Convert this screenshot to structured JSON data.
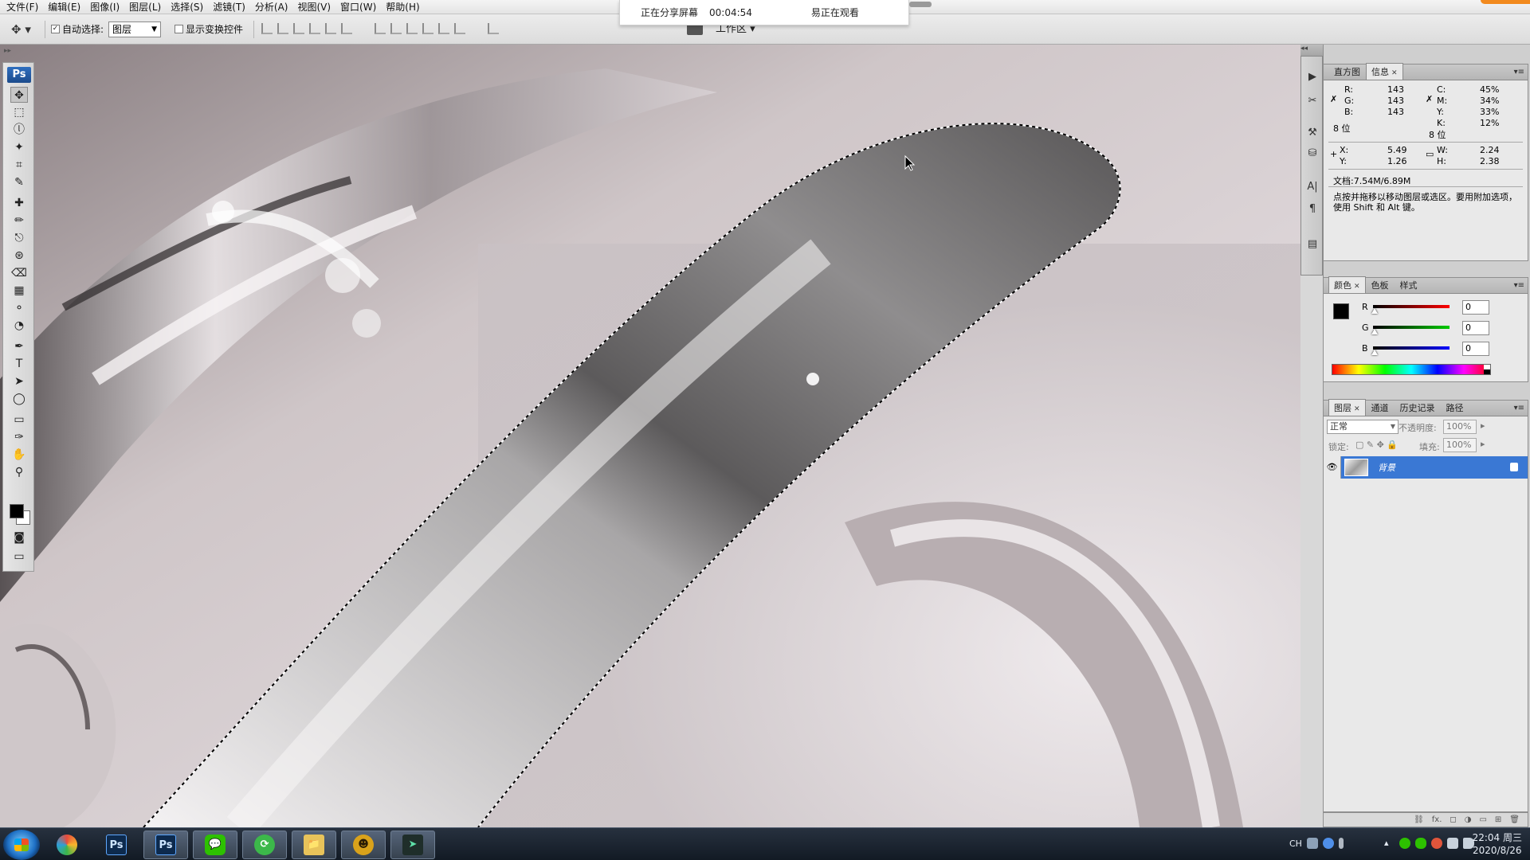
{
  "menu": [
    "文件(F)",
    "编辑(E)",
    "图像(I)",
    "图层(L)",
    "选择(S)",
    "滤镜(T)",
    "分析(A)",
    "视图(V)",
    "窗口(W)",
    "帮助(H)"
  ],
  "options": {
    "auto_select_label": "自动选择:",
    "auto_select_value": "图层",
    "auto_select_checked": "✓",
    "show_transform_label": "显示变换控件",
    "workspace_label": "工作区"
  },
  "share_banner": {
    "status": "正在分享屏幕",
    "elapsed": "00:04:54",
    "viewers": "易正在观看"
  },
  "toolbox": {
    "logo": "Ps",
    "tools": [
      "✥",
      "⬚",
      "ⓛ",
      "✦",
      "⌗",
      "✎",
      "✚",
      "✏",
      "⎋",
      "⊛",
      "⌫",
      "▦",
      "⚬",
      "◔",
      "✒",
      "T",
      "➤",
      "◯",
      "▭",
      "✑",
      "✋",
      "⚲"
    ],
    "fg_color": "#000000",
    "bg_color": "#ffffff"
  },
  "dock_icons": [
    "▶",
    "✂",
    "⚒",
    "⛁",
    "A|",
    "¶",
    "▤"
  ],
  "info_panel": {
    "tabs": [
      "直方图",
      "信息"
    ],
    "r_label": "R:",
    "r": "143",
    "g_label": "G:",
    "g": "143",
    "b_label": "B:",
    "b": "143",
    "c_label": "C:",
    "c": "45%",
    "m_label": "M:",
    "m": "34%",
    "y_label": "Y:",
    "y": "33%",
    "k_label": "K:",
    "k": "12%",
    "bits_left": "8 位",
    "bits_right": "8 位",
    "x_label": "X:",
    "x": "5.49",
    "yy_label": "Y:",
    "yy": "1.26",
    "w_label": "W:",
    "w": "2.24",
    "h_label": "H:",
    "h": "2.38",
    "doc": "文档:7.54M/6.89M",
    "hint": "点按并拖移以移动图层或选区。要用附加选项，使用 Shift 和 Alt 键。"
  },
  "color_panel": {
    "tabs": [
      "颜色",
      "色板",
      "样式"
    ],
    "r_label": "R",
    "r": "0",
    "g_label": "G",
    "g": "0",
    "b_label": "B",
    "b": "0"
  },
  "layers_panel": {
    "tabs": [
      "图层",
      "通道",
      "历史记录",
      "路径"
    ],
    "blend_mode": "正常",
    "opacity_label": "不透明度:",
    "opacity": "100%",
    "lock_label": "锁定:",
    "fill_label": "填充:",
    "fill": "100%",
    "layer_name": "背景",
    "eye": "👁",
    "bottom_icons": [
      "⛓",
      "fx.",
      "◻",
      "◑",
      "▭",
      "⊞",
      "🗑"
    ]
  },
  "taskbar": {
    "apps": [
      {
        "icon": "ps-icon",
        "label": "Ps"
      },
      {
        "icon": "ps-icon",
        "label": "Ps"
      },
      {
        "icon": "wechat-icon",
        "label": "💬"
      },
      {
        "icon": "refresh-app-icon",
        "label": "⟳"
      },
      {
        "icon": "folder-icon",
        "label": "📁"
      },
      {
        "icon": "avatar-app-icon",
        "label": "☻"
      },
      {
        "icon": "arrow-app-icon",
        "label": "➤"
      }
    ],
    "lang": "CH",
    "time": "22:04 周三",
    "date": "2020/8/26"
  },
  "colors": {
    "selection_tab": "#3a78d4",
    "share_bar": "#ffffff",
    "taskbar": "#1a2230",
    "orange_accent": "#f28a1e"
  }
}
